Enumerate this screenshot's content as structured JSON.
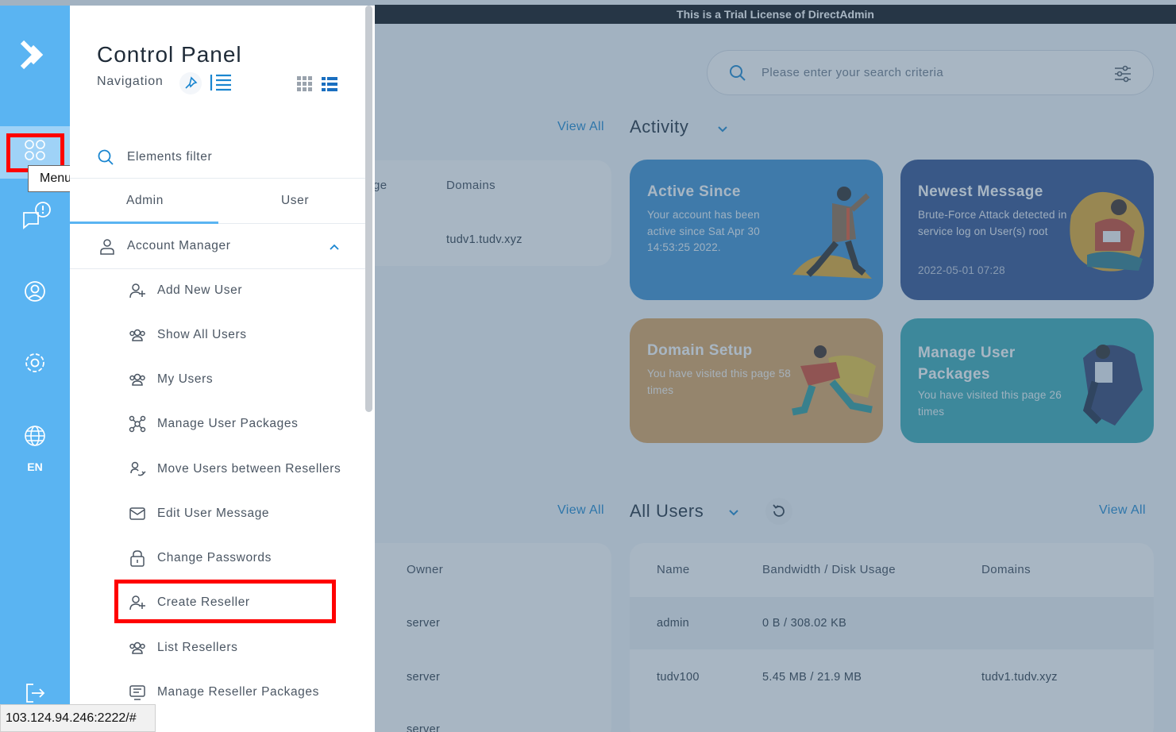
{
  "trial_banner": "This is a Trial License of DirectAdmin",
  "search": {
    "placeholder": "Please enter your search criteria"
  },
  "sections": {
    "view_all_1": "View All",
    "activity": "Activity",
    "view_all_2": "View All",
    "all_users": "All Users",
    "view_all_3": "View All"
  },
  "left_table": {
    "col_partial": "ge",
    "col_domains": "Domains",
    "row_domain": "tudv1.tudv.xyz"
  },
  "cards": [
    {
      "title": "Active Since",
      "desc": "Your account has been active since Sat Apr 30 14:53:25 2022.",
      "color": "#3a8fd0"
    },
    {
      "title": "Newest Message",
      "desc": "Brute-Force Attack detected in service log on User(s) root",
      "date": "2022-05-01 07:28",
      "color": "#2f4f8e"
    },
    {
      "title": "Domain Setup",
      "desc": "You have visited this page 58 times",
      "color": "#dba25e"
    },
    {
      "title": "Manage User Packages",
      "desc": "You have visited this page 26 times",
      "color": "#36a9b3"
    }
  ],
  "resellers_table": {
    "owner_header": "Owner",
    "rows": [
      "server",
      "server",
      "server"
    ]
  },
  "users_table": {
    "headers": [
      "Name",
      "Bandwidth / Disk Usage",
      "Domains"
    ],
    "rows": [
      {
        "name": "admin",
        "usage": "0 B / 308.02 KB",
        "domains": ""
      },
      {
        "name": "tudv100",
        "usage": "5.45 MB / 21.9 MB",
        "domains": "tudv1.tudv.xyz"
      }
    ]
  },
  "rail": {
    "menu_tooltip": "Menu",
    "language": "EN",
    "accent": "#5ab4f2"
  },
  "drawer": {
    "title": "Control Panel",
    "subtitle": "Navigation",
    "filter_label": "Elements filter",
    "tabs": [
      "Admin",
      "User"
    ],
    "section": "Account Manager",
    "items": [
      {
        "label": "Add New User",
        "icon": "user-plus-icon"
      },
      {
        "label": "Show All Users",
        "icon": "users-icon"
      },
      {
        "label": "My Users",
        "icon": "users-icon"
      },
      {
        "label": "Manage User Packages",
        "icon": "packages-icon"
      },
      {
        "label": "Move Users between Resellers",
        "icon": "move-user-icon"
      },
      {
        "label": "Edit User Message",
        "icon": "envelope-icon"
      },
      {
        "label": "Change Passwords",
        "icon": "lock-icon"
      },
      {
        "label": "Create Reseller",
        "icon": "user-plus-icon"
      },
      {
        "label": "List Resellers",
        "icon": "users-icon"
      },
      {
        "label": "Manage Reseller Packages",
        "icon": "monitor-icon"
      }
    ]
  },
  "status_url": "103.124.94.246:2222/#"
}
